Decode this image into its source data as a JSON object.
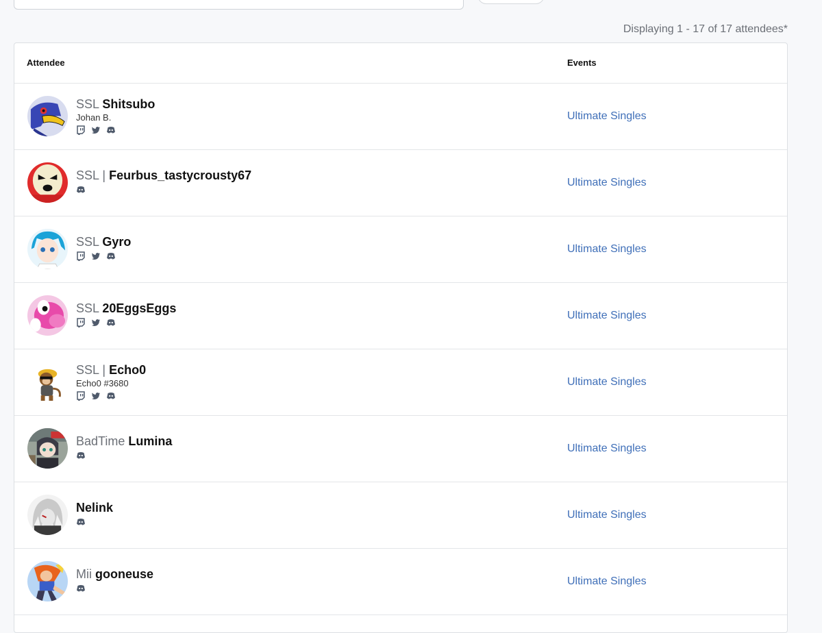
{
  "count_text": "Displaying 1 - 17 of 17 attendees*",
  "table": {
    "headers": {
      "attendee": "Attendee",
      "events": "Events"
    },
    "rows": [
      {
        "prefix": "SSL",
        "sep": "",
        "gamertag": "Shitsubo",
        "realname": "Johan B.",
        "socials": [
          "twitch-icon",
          "twitter-icon",
          "discord-icon"
        ],
        "event": "Ultimate Singles",
        "avatar": "falco"
      },
      {
        "prefix": "SSL",
        "sep": "|",
        "gamertag": "Feurbus_tastycrousty67",
        "realname": "",
        "socials": [
          "discord-icon"
        ],
        "event": "Ultimate Singles",
        "avatar": "shyguy"
      },
      {
        "prefix": "SSL",
        "sep": "",
        "gamertag": "Gyro",
        "realname": "",
        "socials": [
          "twitch-icon",
          "twitter-icon",
          "discord-icon"
        ],
        "event": "Ultimate Singles",
        "avatar": "anime-blue"
      },
      {
        "prefix": "SSL",
        "sep": "",
        "gamertag": "20EggsEggs",
        "realname": "",
        "socials": [
          "twitch-icon",
          "twitter-icon",
          "discord-icon"
        ],
        "event": "Ultimate Singles",
        "avatar": "yoshi-pink"
      },
      {
        "prefix": "SSL",
        "sep": "|",
        "gamertag": "Echo0",
        "realname": "Echo0 #3680",
        "socials": [
          "twitch-icon",
          "twitter-icon",
          "discord-icon"
        ],
        "event": "Ultimate Singles",
        "avatar": "monkey"
      },
      {
        "prefix": "BadTime",
        "sep": "",
        "gamertag": "Lumina",
        "realname": "",
        "socials": [
          "discord-icon"
        ],
        "event": "Ultimate Singles",
        "avatar": "figure-photo"
      },
      {
        "prefix": "",
        "sep": "",
        "gamertag": "Nelink",
        "realname": "",
        "socials": [
          "discord-icon"
        ],
        "event": "Ultimate Singles",
        "avatar": "anime-gray"
      },
      {
        "prefix": "Mii",
        "sep": "",
        "gamertag": "gooneuse",
        "realname": "",
        "socials": [
          "discord-icon"
        ],
        "event": "Ultimate Singles",
        "avatar": "fighter-orange"
      }
    ]
  },
  "colors": {
    "link": "#3f6fb8",
    "prefix": "#6b6f76",
    "icon": "#4f5a6b"
  }
}
